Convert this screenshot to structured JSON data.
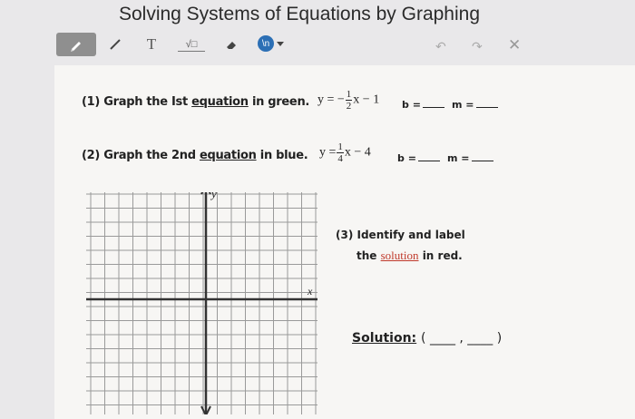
{
  "title": "Solving Systems of Equations by Graphing",
  "toolbar": {
    "text_tool_label": "T",
    "sqrt_tool_label": "√□",
    "dropdown_label": "\\n"
  },
  "q1": {
    "label_prefix": "(1) Graph the Ist ",
    "label_link": "equation",
    "label_suffix": " in green.",
    "eq_lhs": "y = −",
    "eq_num": "1",
    "eq_den": "2",
    "eq_rhs": "x − 1",
    "b_label": "b =",
    "m_label": "m ="
  },
  "q2": {
    "label_prefix": "(2) Graph the 2nd ",
    "label_link": "equation",
    "label_suffix": " in blue.",
    "eq_lhs": "y =",
    "eq_num": "1",
    "eq_den": "4",
    "eq_rhs": "x − 4",
    "b_label": "b =",
    "m_label": "m ="
  },
  "graph": {
    "y_axis_label": "y",
    "x_axis_label": "x"
  },
  "q3": {
    "line1": "(3) Identify and label",
    "line2_prefix": "the ",
    "line2_link": "solution",
    "line2_suffix": " in red."
  },
  "solution": {
    "label": "Solution:",
    "value": "( ____ , ____ )"
  },
  "colors": {
    "accent": "#2c6fb5",
    "red": "#c0392b"
  }
}
